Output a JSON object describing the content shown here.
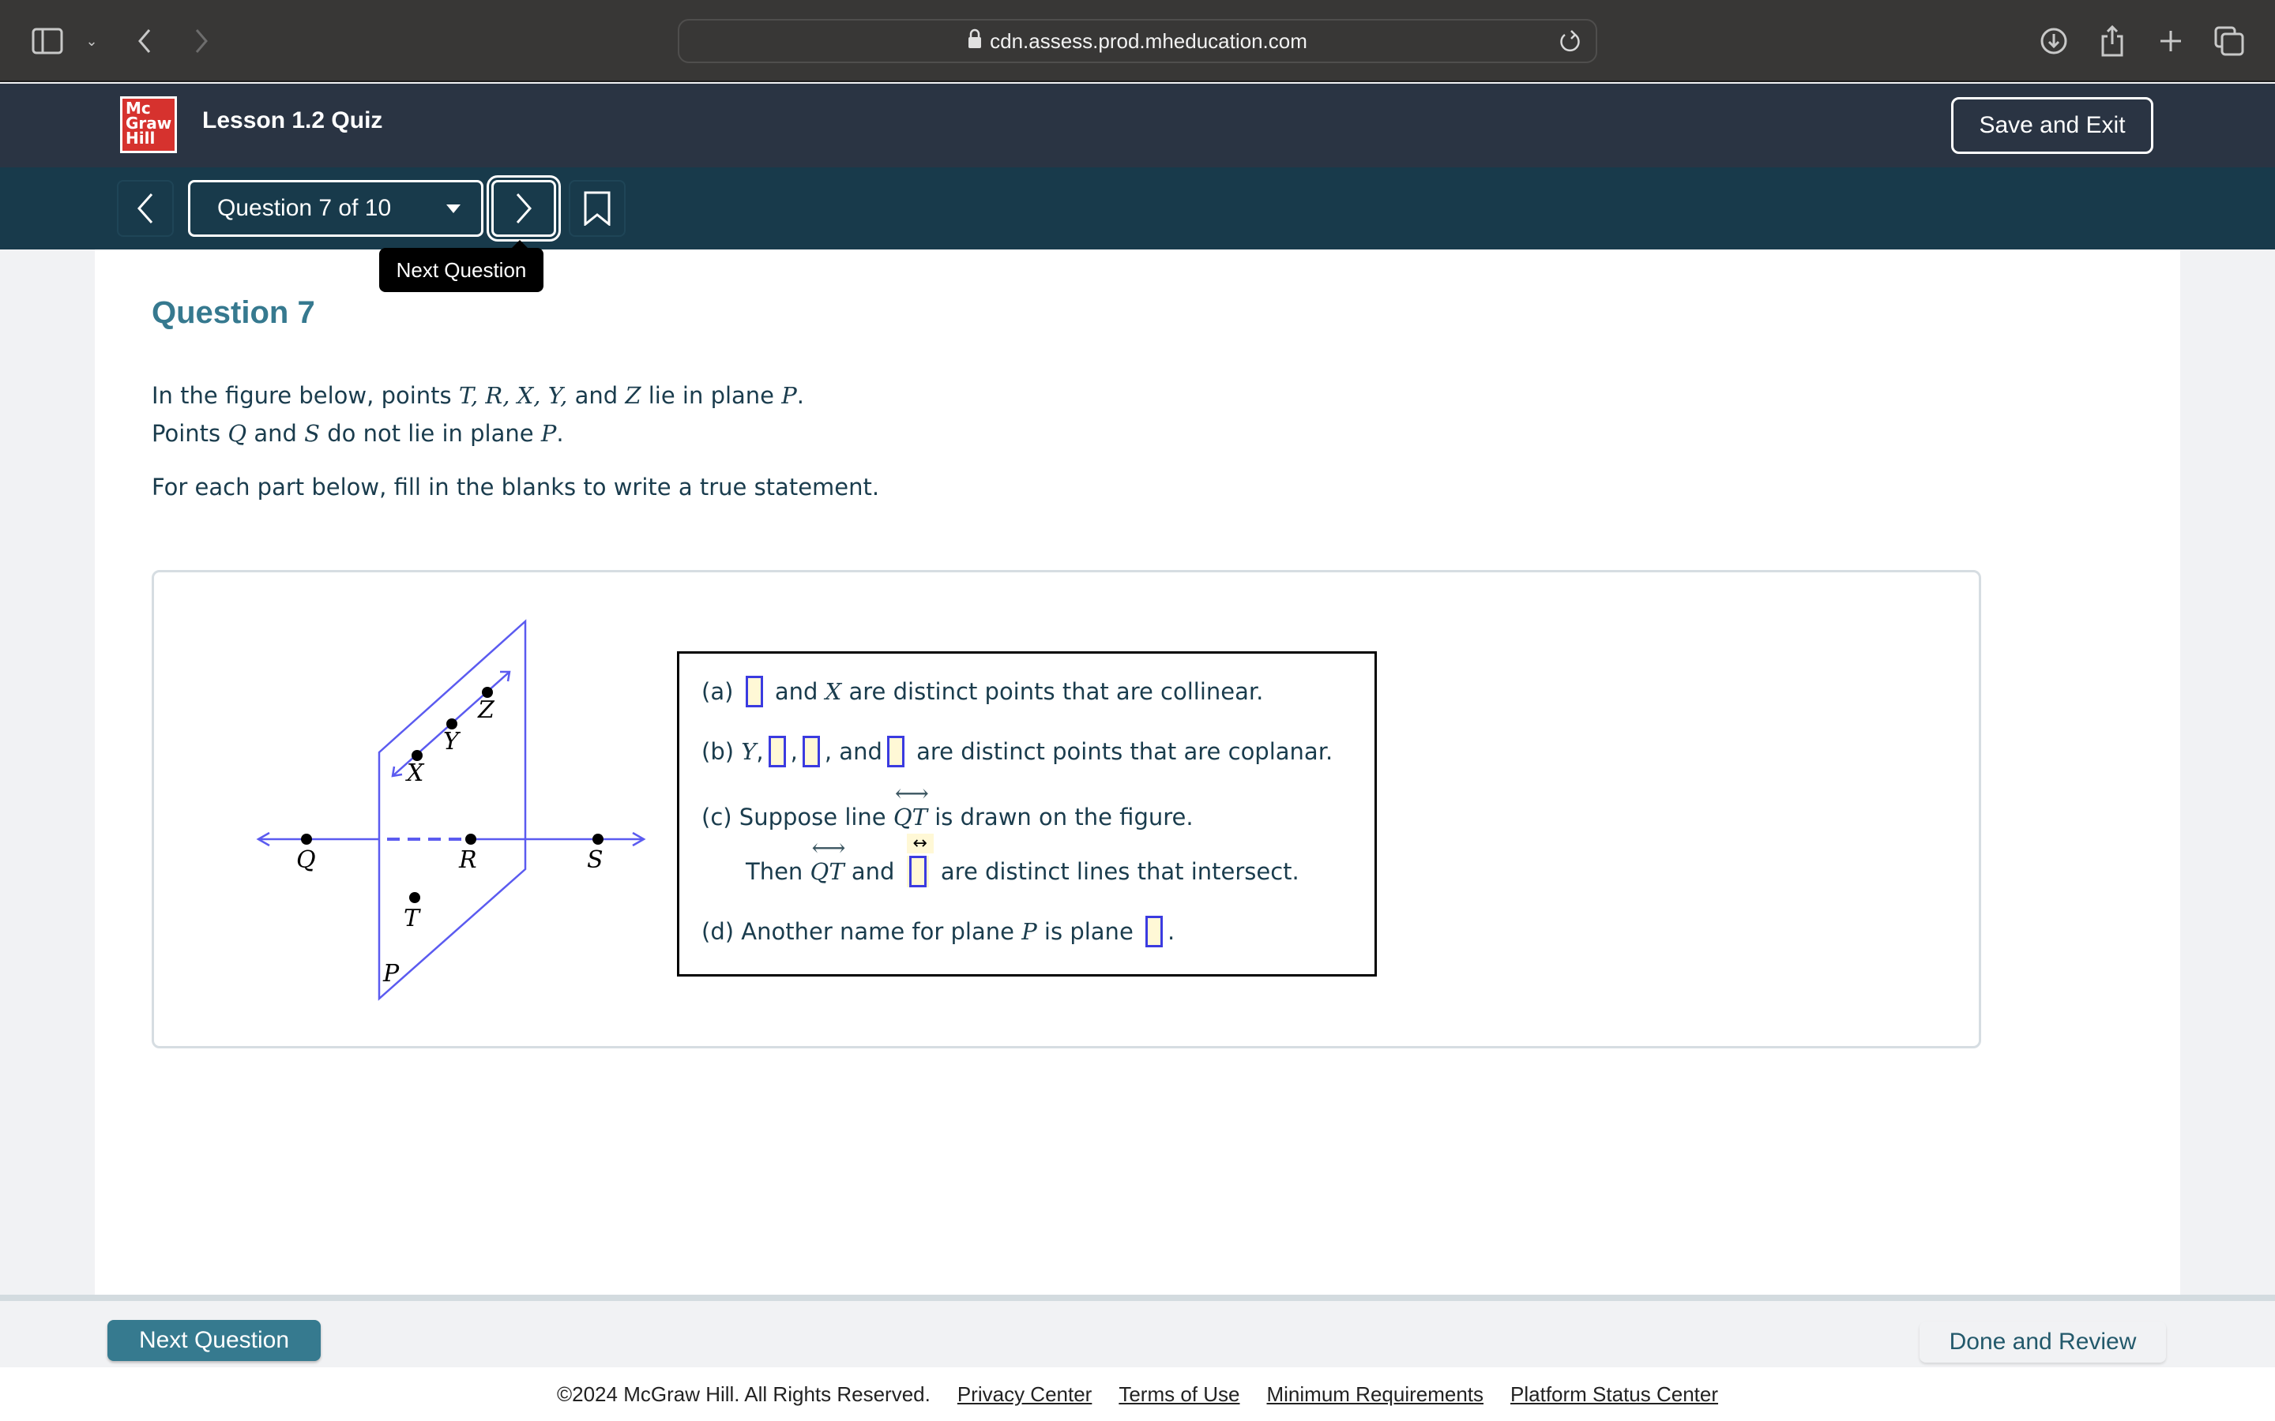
{
  "browser": {
    "url": "cdn.assess.prod.mheducation.com"
  },
  "header": {
    "logo_lines": [
      "Mc",
      "Graw",
      "Hill"
    ],
    "title": "Lesson 1.2 Quiz",
    "save_exit_label": "Save and Exit"
  },
  "nav": {
    "question_selector": "Question 7 of 10",
    "tooltip": "Next Question"
  },
  "question": {
    "title": "Question 7",
    "stem_line1_pre": "In the figure below, points ",
    "stem_line1_points": "T, R, X, Y,",
    "stem_line1_and": " and ",
    "stem_line1_z": "Z",
    "stem_line1_post": " lie in plane ",
    "stem_plane": "P",
    "stem_line2_pre": "Points ",
    "stem_line2_q": "Q",
    "stem_line2_and": " and ",
    "stem_line2_s": "S",
    "stem_line2_post": " do not lie in plane ",
    "instruction": "For each part below, fill in the blanks to write a true statement."
  },
  "figure": {
    "points": [
      "Q",
      "R",
      "S",
      "T",
      "X",
      "Y",
      "Z"
    ],
    "plane_label": "P",
    "line_color": "#5b5bf0"
  },
  "parts": {
    "a": {
      "label": "(a)",
      "mid": " and ",
      "var": "X",
      "post": " are distinct points that are collinear."
    },
    "b": {
      "label": "(b)",
      "var": "Y",
      "sep": ",",
      "and": ", and",
      "post": " are distinct points that are coplanar."
    },
    "c": {
      "label": "(c)",
      "pre": "Suppose line ",
      "line": "QT",
      "post": " is drawn on the figure.",
      "then": "Then ",
      "and": " and ",
      "post2": " are distinct lines that intersect."
    },
    "d": {
      "label": "(d)",
      "pre": "Another name for plane ",
      "var": "P",
      "mid": " is plane ",
      "post": "."
    }
  },
  "footer": {
    "next_label": "Next Question",
    "done_label": "Done and Review",
    "copyright": "©2024 McGraw Hill. All Rights Reserved.",
    "links": [
      "Privacy Center",
      "Terms of Use",
      "Minimum Requirements",
      "Platform Status Center"
    ]
  },
  "colors": {
    "accent": "#367a8f",
    "header": "#2a3443",
    "navbar": "#183a4b",
    "blank_border": "#3b3be0",
    "blank_fill": "#fff8d6"
  }
}
